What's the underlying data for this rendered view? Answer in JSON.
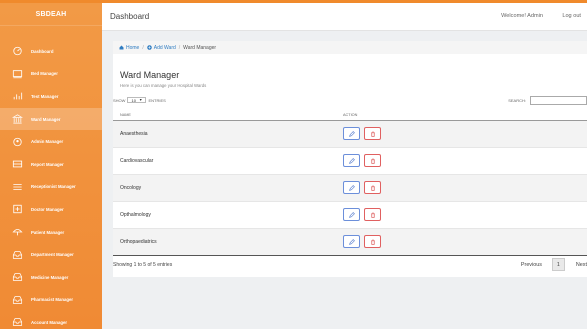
{
  "brand": "SBDEAH",
  "sidebar": {
    "items": [
      {
        "label": "Dashboard",
        "icon": "dashboard-icon",
        "active": false
      },
      {
        "label": "Bed Manager",
        "icon": "bed-icon",
        "active": false
      },
      {
        "label": "Test Manager",
        "icon": "bar-chart-icon",
        "active": false
      },
      {
        "label": "Ward Manager",
        "icon": "building-icon",
        "active": true
      },
      {
        "label": "Admin Manager",
        "icon": "user-shield-icon",
        "active": false
      },
      {
        "label": "Report Manager",
        "icon": "report-icon",
        "active": false
      },
      {
        "label": "Receptionist Manager",
        "icon": "list-icon",
        "active": false
      },
      {
        "label": "Doctor Manager",
        "icon": "hospital-icon",
        "active": false
      },
      {
        "label": "Patient Manager",
        "icon": "umbrella-icon",
        "active": false
      },
      {
        "label": "Department Manager",
        "icon": "tray-icon",
        "active": false
      },
      {
        "label": "Medicine Manager",
        "icon": "tray-icon",
        "active": false
      },
      {
        "label": "Pharmacist Manager",
        "icon": "tray-icon",
        "active": false
      },
      {
        "label": "Account Manager",
        "icon": "tray-icon",
        "active": false
      }
    ]
  },
  "header": {
    "title": "Dashboard",
    "welcome": "Welcome! Admin",
    "logout": "Log out"
  },
  "breadcrumb": {
    "home": "Home",
    "add_ward": "Add Ward",
    "current": "Ward Manager"
  },
  "page": {
    "title": "Ward Manager",
    "subtitle": "Here is you can manage your Hospital Wards"
  },
  "table_controls": {
    "show_label": "SHOW",
    "entries_value": "10",
    "entries_label": "ENTRIES",
    "search_label": "SEARCH:",
    "search_placeholder": ""
  },
  "table": {
    "headers": [
      "NAME",
      "ACTION"
    ],
    "rows": [
      "Anaesthesia",
      "Cardiovascular",
      "Oncology",
      "Opthalmology",
      "Orthopaediatrics"
    ]
  },
  "footer": {
    "info": "Showing 1 to 5 of 5 entries",
    "previous": "Previous",
    "page": "1",
    "next": "Next"
  },
  "colors": {
    "sidebar": "#f08a34",
    "link": "#2f7cc1",
    "edit": "#6c8fda",
    "delete": "#e06060"
  }
}
